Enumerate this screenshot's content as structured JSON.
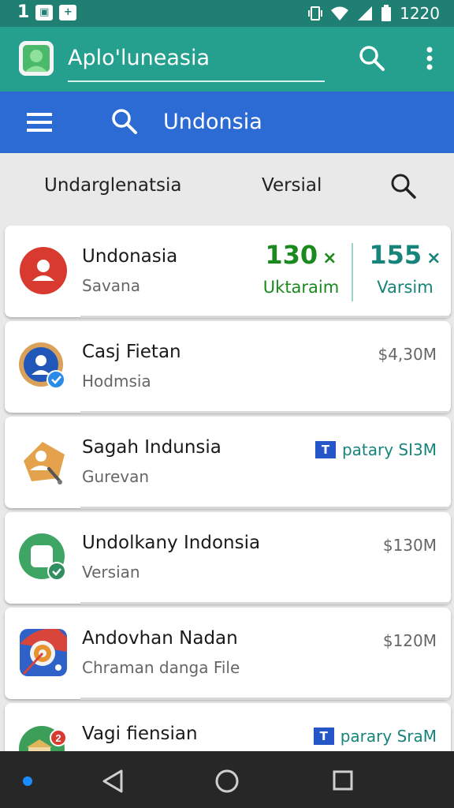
{
  "status_bar": {
    "left_number": "1",
    "right_time": "1220"
  },
  "app_bar": {
    "title": "Aplo'luneasia",
    "avatar_icon": "person-avatar-icon",
    "search_icon": "search-icon",
    "more_icon": "more-vert-icon"
  },
  "search_bar": {
    "text": "Undonsia",
    "menu_icon": "menu-icon",
    "search_icon": "search-icon"
  },
  "tabs": {
    "tab1": "Undarglenatsia",
    "tab2": "Versial",
    "search_icon": "search-icon"
  },
  "list": [
    {
      "name": "Undonasia",
      "sub": "Savana",
      "icon": "person-red-circle-icon",
      "stats": [
        {
          "value": "130",
          "suffix": "×",
          "label": "Uktaraim",
          "color": "#1a8a1e"
        },
        {
          "value": "155",
          "suffix": "×",
          "label": "Varsim",
          "color": "#16847a"
        }
      ]
    },
    {
      "name": "Casj Fietan",
      "sub": "Hodmsia",
      "right": "$4,30M",
      "icon": "person-blue-badge-icon"
    },
    {
      "name": "Sagah Indunsia",
      "sub": "Gurevan",
      "tag_letter": "T",
      "tag_text": "patary SI3M",
      "icon": "person-orange-tool-icon"
    },
    {
      "name": "Undolkany Indonsia",
      "sub": "Versian",
      "right": "$130M",
      "icon": "green-square-badge-icon"
    },
    {
      "name": "Andovhan Nadan",
      "sub": "Chraman danga File",
      "right": "$120M",
      "icon": "target-app-icon"
    },
    {
      "name": "Vagi fiensian",
      "sub": "",
      "tag_letter": "T",
      "tag_text": "parary SraM",
      "icon": "green-store-badge-icon"
    }
  ],
  "nav_bar": {
    "back_icon": "back-triangle-icon",
    "home_icon": "home-circle-icon",
    "recent_icon": "recent-square-icon"
  },
  "colors": {
    "status_bar": "#1f7f73",
    "app_bar": "#25a08e",
    "search_bar": "#2d6bd4",
    "nav_bar": "#272727",
    "accent_green": "#1a8a1e",
    "accent_teal": "#16847a"
  }
}
